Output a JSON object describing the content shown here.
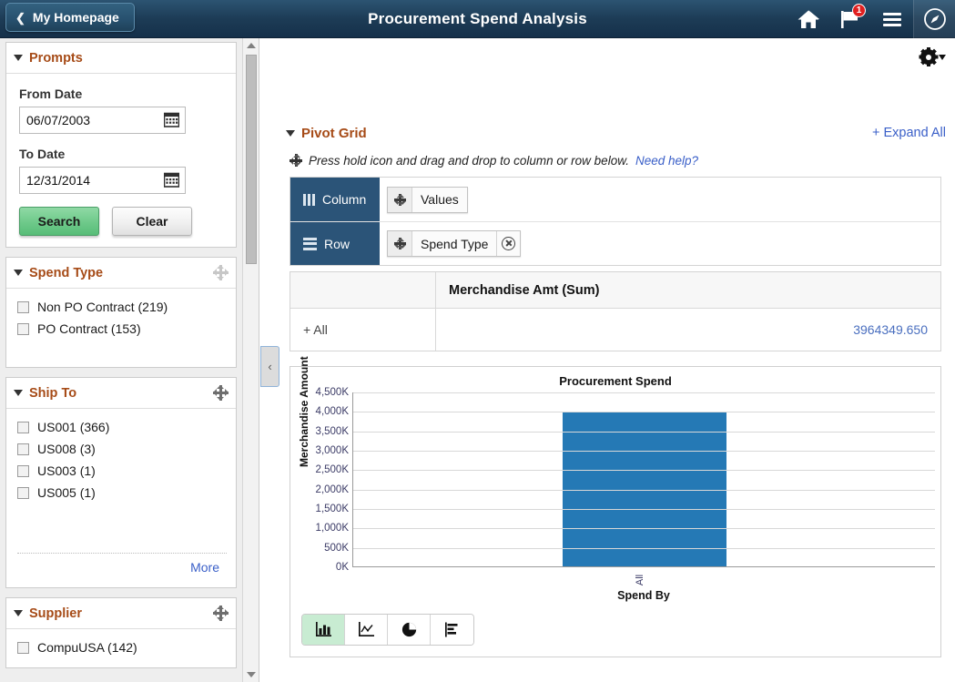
{
  "header": {
    "back_label": "My Homepage",
    "back_icon": "chevron-left-icon",
    "title": "Procurement Spend Analysis",
    "icons": [
      {
        "name": "home-icon",
        "glyph": "home"
      },
      {
        "name": "notifications-flag-icon",
        "glyph": "flag",
        "badge": "1"
      },
      {
        "name": "nav-menu-icon",
        "glyph": "hamburger"
      },
      {
        "name": "actions-compass-icon",
        "glyph": "compass"
      }
    ]
  },
  "sidebar": {
    "scroll": {
      "up_icon": "scroll-up-arrow-icon",
      "down_icon": "scroll-down-arrow-icon"
    },
    "collapse_handle": {
      "name": "sidebar-collapse-handle",
      "glyph": "‹"
    },
    "prompts": {
      "title": "Prompts",
      "from_label": "From Date",
      "from_value": "06/07/2003",
      "to_label": "To Date",
      "to_value": "12/31/2014",
      "calendar_icon": "calendar-icon",
      "search_label": "Search",
      "clear_label": "Clear"
    },
    "facets": [
      {
        "title": "Spend Type",
        "draggable": true,
        "handle_dim": true,
        "items": [
          {
            "label": "Non PO Contract (219)",
            "checked": false
          },
          {
            "label": "PO Contract (153)",
            "checked": false
          }
        ],
        "more": null
      },
      {
        "title": "Ship To",
        "draggable": true,
        "handle_dim": false,
        "items": [
          {
            "label": "US001 (366)",
            "checked": false
          },
          {
            "label": "US008 (3)",
            "checked": false
          },
          {
            "label": "US003 (1)",
            "checked": false
          },
          {
            "label": "US005 (1)",
            "checked": false
          }
        ],
        "more": "More"
      },
      {
        "title": "Supplier",
        "draggable": true,
        "handle_dim": false,
        "items": [
          {
            "label": "CompuUSA (142)",
            "checked": false
          }
        ],
        "more": null
      }
    ]
  },
  "main": {
    "gear_icon": "settings-gear-icon",
    "gear_caret_icon": "chevron-down-icon",
    "pivot_grid_title": "Pivot Grid",
    "expand_all_label": "+ Expand All",
    "hint_icon": "drag-move-icon",
    "hint_text": "Press hold icon and drag and drop to column or row below.",
    "need_help_label": "Need help?",
    "dropzones": [
      {
        "zone": "Column",
        "zone_icon": "column-layout-icon",
        "chips": [
          {
            "label": "Values",
            "grip_icon": "drag-move-icon",
            "removable": false
          }
        ]
      },
      {
        "zone": "Row",
        "zone_icon": "row-layout-icon",
        "chips": [
          {
            "label": "Spend Type",
            "grip_icon": "drag-move-icon",
            "removable": true,
            "remove_icon": "remove-circle-icon"
          }
        ]
      }
    ],
    "table": {
      "corner_header": "",
      "measure_header": "Merchandise Amt (Sum)",
      "rows": [
        {
          "label": "+ All",
          "value": "3964349.650"
        }
      ]
    },
    "chart_toolbar": [
      {
        "name": "chart-type-bar",
        "icon": "bar-chart-icon",
        "active": true
      },
      {
        "name": "chart-type-line",
        "icon": "line-chart-icon",
        "active": false
      },
      {
        "name": "chart-type-pie",
        "icon": "pie-chart-icon",
        "active": false
      },
      {
        "name": "chart-type-hbar",
        "icon": "horizontal-bar-chart-icon",
        "active": false
      }
    ]
  },
  "chart_data": {
    "type": "bar",
    "title": "Procurement Spend",
    "xlabel": "Spend By",
    "ylabel": "Merchandise Amount",
    "categories": [
      "All"
    ],
    "values": [
      3964349.65
    ],
    "ylim": [
      0,
      4500000
    ],
    "yticks": [
      0,
      500000,
      1000000,
      1500000,
      2000000,
      2500000,
      3000000,
      3500000,
      4000000,
      4500000
    ],
    "ytick_labels": [
      "0K",
      "500K",
      "1,000K",
      "1,500K",
      "2,000K",
      "2,500K",
      "3,000K",
      "3,500K",
      "4,000K",
      "4,500K"
    ],
    "series": [
      {
        "name": "Merchandise Amt (Sum)",
        "values": [
          3964349.65
        ],
        "color": "#2579b5"
      }
    ],
    "grid": true,
    "legend": "none"
  },
  "colors": {
    "header_blue": "#1d3c56",
    "panel_title_orange": "#a64b17",
    "link_blue": "#3a5fc8",
    "dropzone_blue": "#2b5478",
    "bar_blue": "#2579b5",
    "search_green": "#6ec98a"
  }
}
